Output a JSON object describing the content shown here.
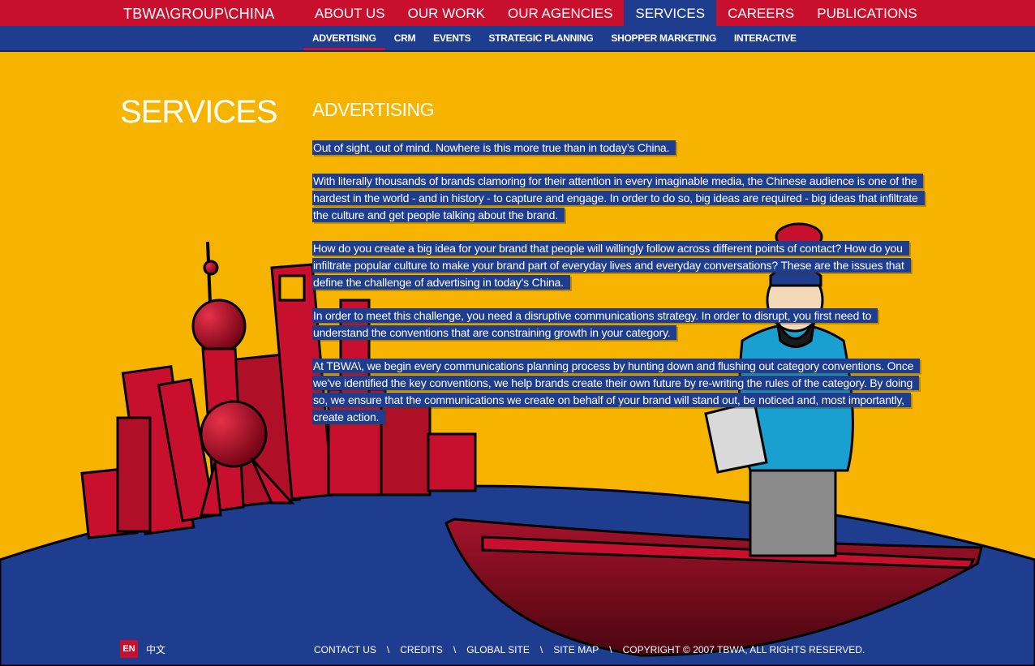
{
  "brand": "TBWA\\GROUP\\CHINA",
  "main_nav": [
    {
      "label": "ABOUT US",
      "active": false
    },
    {
      "label": "OUR WORK",
      "active": false
    },
    {
      "label": "OUR AGENCIES",
      "active": false
    },
    {
      "label": "SERVICES",
      "active": true
    },
    {
      "label": "CAREERS",
      "active": false
    },
    {
      "label": "PUBLICATIONS",
      "active": false
    }
  ],
  "sub_nav": [
    {
      "label": "ADVERTISING",
      "active": true
    },
    {
      "label": "CRM",
      "active": false
    },
    {
      "label": "EVENTS",
      "active": false
    },
    {
      "label": "STRATEGIC PLANNING",
      "active": false
    },
    {
      "label": "SHOPPER MARKETING",
      "active": false
    },
    {
      "label": "INTERACTIVE",
      "active": false
    }
  ],
  "page_title": "SERVICES",
  "section_title": "ADVERTISING",
  "paragraphs": [
    "Out of sight, out of mind. Nowhere is this more true than in today’s China.",
    "With literally thousands of brands clamoring for their attention in every imaginable media, the Chinese audience is one of the hardest in the world - and in history - to capture and engage. In order to do so, big ideas are required - big ideas that infiltrate the culture and get people talking about the brand.",
    "How do you create a big idea for your brand that people will willingly follow across different points of contact? How do you infiltrate popular culture to make your brand part of everyday lives and everyday conversations? These are the issues that define the challenge of advertising in today's China.",
    "In order to meet this challenge, you need a disruptive communications strategy. In order to disrupt, you first need to understand the conventions that are constraining growth in your category.",
    "At TBWA\\, we begin every communications planning process by hunting down and flushing out category conventions. Once we've identified the key conventions, we help brands create their own future by re-writing the rules of the category. By doing so, we ensure that the communications we create on behalf of your brand will stand out, be noticed and, most importantly, create action."
  ],
  "language": {
    "en": "EN",
    "cn": "中文"
  },
  "footer": {
    "links": [
      "CONTACT US",
      "CREDITS",
      "GLOBAL SITE",
      "SITE MAP"
    ],
    "separator": "\\",
    "copyright": "COPYRIGHT © 2007 TBWA, ALL RIGHTS RESERVED."
  },
  "colors": {
    "background": "#f6b400",
    "primary_red": "#c8102e",
    "navy": "#1f3d8f"
  }
}
